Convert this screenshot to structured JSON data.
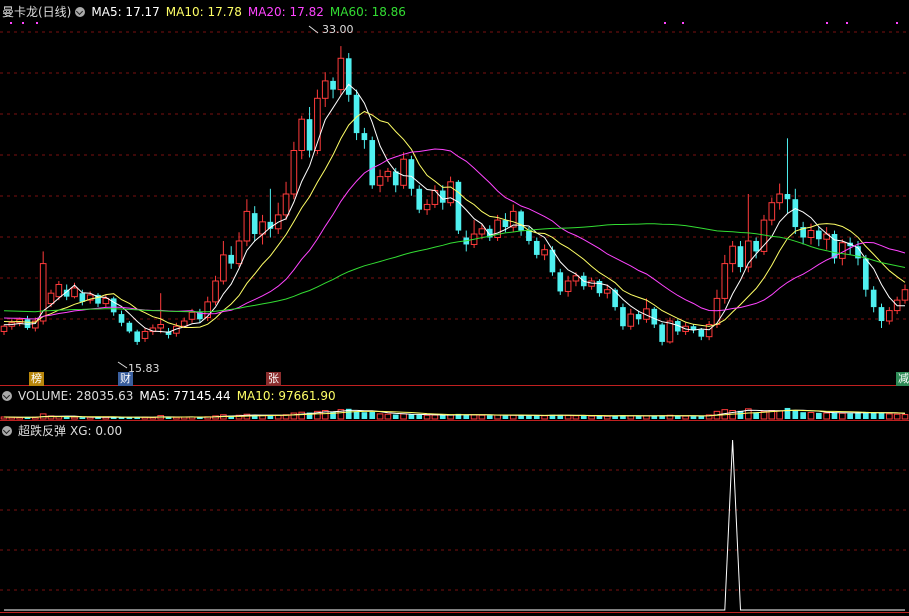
{
  "header": {
    "stock_title": "曼卡龙(日线)",
    "ma5": "MA5: 17.17",
    "ma10": "MA10: 17.78",
    "ma20": "MA20: 17.82",
    "ma60": "MA60: 18.86"
  },
  "volume_header": {
    "volume": "VOLUME: 28035.63",
    "ma5": "MA5: 77145.44",
    "ma10": "MA10: 97661.90"
  },
  "indicator_header": {
    "name": "超跌反弹",
    "xg": "XG: 0.00"
  },
  "annotations": {
    "high_label": "33.00",
    "low_label": "15.83"
  },
  "event_tags": [
    {
      "label": "榜",
      "color": "#b8860b"
    },
    {
      "label": "财",
      "color": "#3a5f9f"
    },
    {
      "label": "张",
      "color": "#8b2d2d"
    },
    {
      "label": "减",
      "color": "#2e8b57"
    }
  ],
  "colors": {
    "up": "#ff3b3b",
    "down": "#4ff0f0",
    "ma5": "#ffffff",
    "ma10": "#ffff66",
    "ma20": "#ff44ff",
    "ma60": "#33dd33",
    "grid": "#7a1010",
    "axis": "#c02020"
  },
  "chart_data": {
    "type": "candlestick",
    "price_range": [
      14.5,
      34.5
    ],
    "candles": [
      [
        16.6,
        16.9,
        16.4,
        17.0
      ],
      [
        16.9,
        17.1,
        16.7,
        17.3
      ],
      [
        17.1,
        17.3,
        16.9,
        17.4
      ],
      [
        17.3,
        16.8,
        16.7,
        17.5
      ],
      [
        16.8,
        17.2,
        16.6,
        17.4
      ],
      [
        17.2,
        20.5,
        17.0,
        21.2
      ],
      [
        18.2,
        18.8,
        18.0,
        19.0
      ],
      [
        18.6,
        19.3,
        18.4,
        19.5
      ],
      [
        19.0,
        18.6,
        18.4,
        19.3
      ],
      [
        18.6,
        19.1,
        18.5,
        19.4
      ],
      [
        18.8,
        18.3,
        18.1,
        19.0
      ],
      [
        18.4,
        18.7,
        18.2,
        18.9
      ],
      [
        18.7,
        18.2,
        18.0,
        18.8
      ],
      [
        18.2,
        18.5,
        18.0,
        18.7
      ],
      [
        18.5,
        17.7,
        17.5,
        18.6
      ],
      [
        17.6,
        17.1,
        16.9,
        17.8
      ],
      [
        17.1,
        16.6,
        16.5,
        17.2
      ],
      [
        16.6,
        16.0,
        15.83,
        16.7
      ],
      [
        16.2,
        16.6,
        16.0,
        16.8
      ],
      [
        16.6,
        16.8,
        16.4,
        17.0
      ],
      [
        16.8,
        17.0,
        16.5,
        18.8
      ],
      [
        16.6,
        16.4,
        16.2,
        16.8
      ],
      [
        16.5,
        16.9,
        16.3,
        17.1
      ],
      [
        16.9,
        17.2,
        16.8,
        17.4
      ],
      [
        17.3,
        17.7,
        17.1,
        17.9
      ],
      [
        17.7,
        17.3,
        17.1,
        17.9
      ],
      [
        17.4,
        18.3,
        17.2,
        18.6
      ],
      [
        18.3,
        19.5,
        18.1,
        19.8
      ],
      [
        19.5,
        21.0,
        19.3,
        21.8
      ],
      [
        21.0,
        20.5,
        20.2,
        21.5
      ],
      [
        20.5,
        21.8,
        20.3,
        22.3
      ],
      [
        21.8,
        23.5,
        21.5,
        24.2
      ],
      [
        23.4,
        22.2,
        21.8,
        23.8
      ],
      [
        22.2,
        22.9,
        21.6,
        23.3
      ],
      [
        22.9,
        22.5,
        22.0,
        24.8
      ],
      [
        22.5,
        23.3,
        22.2,
        24.0
      ],
      [
        23.3,
        24.5,
        23.0,
        25.2
      ],
      [
        24.5,
        27.0,
        24.2,
        27.5
      ],
      [
        27.0,
        28.8,
        26.5,
        29.0
      ],
      [
        28.8,
        27.0,
        26.6,
        29.5
      ],
      [
        27.0,
        30.0,
        26.8,
        30.5
      ],
      [
        30.0,
        31.0,
        29.5,
        31.5
      ],
      [
        31.0,
        30.5,
        30.0,
        31.2
      ],
      [
        30.5,
        32.3,
        30.2,
        33.0
      ],
      [
        32.3,
        30.2,
        29.8,
        32.6
      ],
      [
        30.2,
        28.0,
        27.6,
        30.5
      ],
      [
        28.0,
        27.6,
        27.1,
        28.3
      ],
      [
        27.6,
        25.0,
        24.8,
        27.8
      ],
      [
        25.0,
        25.5,
        24.6,
        25.9
      ],
      [
        25.5,
        25.8,
        25.2,
        26.0
      ],
      [
        25.8,
        25.0,
        24.6,
        26.0
      ],
      [
        25.0,
        26.5,
        24.8,
        26.9
      ],
      [
        26.5,
        24.8,
        24.4,
        26.7
      ],
      [
        24.8,
        23.6,
        23.4,
        25.0
      ],
      [
        23.6,
        23.9,
        23.3,
        24.2
      ],
      [
        23.9,
        24.7,
        23.7,
        25.0
      ],
      [
        24.7,
        24.0,
        23.6,
        25.0
      ],
      [
        24.0,
        25.2,
        23.8,
        25.5
      ],
      [
        25.2,
        22.4,
        22.2,
        25.3
      ],
      [
        22.0,
        21.6,
        21.2,
        22.4
      ],
      [
        21.6,
        22.2,
        21.4,
        23.0
      ],
      [
        22.2,
        22.5,
        21.9,
        22.8
      ],
      [
        22.5,
        22.0,
        21.8,
        22.7
      ],
      [
        22.0,
        23.0,
        21.8,
        23.3
      ],
      [
        23.0,
        22.6,
        22.3,
        23.4
      ],
      [
        22.6,
        23.5,
        22.3,
        23.9
      ],
      [
        23.5,
        22.4,
        22.1,
        23.6
      ],
      [
        22.4,
        21.8,
        21.6,
        22.6
      ],
      [
        21.8,
        21.0,
        20.8,
        22.0
      ],
      [
        21.0,
        21.3,
        20.7,
        21.6
      ],
      [
        21.3,
        20.0,
        19.8,
        21.5
      ],
      [
        20.0,
        18.9,
        18.7,
        20.2
      ],
      [
        18.9,
        19.5,
        18.6,
        19.8
      ],
      [
        19.5,
        19.8,
        19.2,
        20.0
      ],
      [
        19.8,
        19.2,
        19.0,
        20.0
      ],
      [
        19.2,
        19.5,
        19.0,
        19.7
      ],
      [
        19.5,
        18.8,
        18.6,
        19.6
      ],
      [
        18.8,
        19.0,
        18.5,
        19.3
      ],
      [
        19.0,
        18.0,
        17.8,
        19.1
      ],
      [
        18.0,
        16.9,
        16.7,
        18.2
      ],
      [
        16.9,
        17.6,
        16.7,
        17.9
      ],
      [
        17.6,
        17.3,
        17.0,
        17.8
      ],
      [
        17.3,
        17.9,
        17.1,
        18.5
      ],
      [
        17.9,
        17.0,
        16.8,
        18.0
      ],
      [
        17.0,
        16.0,
        15.8,
        17.1
      ],
      [
        16.0,
        17.2,
        15.9,
        17.4
      ],
      [
        17.2,
        16.6,
        16.4,
        17.3
      ],
      [
        16.6,
        16.9,
        16.4,
        17.1
      ],
      [
        16.9,
        16.7,
        16.5,
        17.0
      ],
      [
        16.7,
        16.3,
        16.1,
        16.8
      ],
      [
        16.3,
        17.0,
        16.1,
        17.2
      ],
      [
        17.0,
        18.5,
        16.8,
        19.0
      ],
      [
        18.5,
        20.5,
        18.2,
        21.0
      ],
      [
        20.5,
        21.5,
        20.0,
        21.8
      ],
      [
        21.5,
        20.3,
        20.0,
        21.8
      ],
      [
        20.3,
        21.8,
        20.0,
        24.5
      ],
      [
        21.8,
        21.2,
        20.8,
        22.0
      ],
      [
        21.2,
        23.0,
        21.0,
        23.3
      ],
      [
        23.0,
        24.0,
        22.7,
        24.3
      ],
      [
        24.0,
        24.5,
        23.6,
        25.1
      ],
      [
        24.5,
        24.2,
        23.4,
        27.7
      ],
      [
        24.2,
        22.6,
        22.2,
        24.8
      ],
      [
        22.6,
        22.0,
        21.6,
        22.9
      ],
      [
        22.0,
        22.4,
        21.6,
        22.8
      ],
      [
        22.4,
        21.9,
        21.5,
        22.6
      ],
      [
        21.9,
        22.2,
        21.3,
        22.6
      ],
      [
        22.2,
        20.8,
        20.5,
        22.4
      ],
      [
        20.8,
        21.7,
        20.4,
        21.9
      ],
      [
        21.7,
        21.5,
        21.0,
        22.0
      ],
      [
        21.5,
        20.8,
        20.4,
        21.8
      ],
      [
        20.8,
        19.0,
        18.6,
        21.0
      ],
      [
        19.0,
        18.0,
        17.7,
        19.2
      ],
      [
        18.0,
        17.2,
        16.8,
        18.2
      ],
      [
        17.2,
        17.8,
        17.0,
        18.0
      ],
      [
        17.8,
        18.4,
        17.6,
        18.6
      ],
      [
        18.4,
        19.0,
        18.2,
        19.3
      ]
    ],
    "volume_scale_max": 100,
    "volumes": [
      12,
      10,
      9,
      11,
      10,
      30,
      18,
      14,
      12,
      11,
      10,
      10,
      9,
      10,
      12,
      11,
      10,
      12,
      10,
      9,
      20,
      10,
      10,
      11,
      12,
      11,
      13,
      18,
      25,
      20,
      22,
      28,
      24,
      20,
      22,
      21,
      25,
      35,
      40,
      38,
      45,
      50,
      42,
      55,
      60,
      45,
      40,
      42,
      30,
      28,
      26,
      30,
      27,
      25,
      22,
      23,
      22,
      24,
      30,
      26,
      24,
      22,
      21,
      23,
      20,
      22,
      21,
      20,
      22,
      19,
      25,
      24,
      20,
      19,
      18,
      17,
      19,
      16,
      20,
      22,
      18,
      17,
      18,
      19,
      21,
      22,
      18,
      17,
      16,
      18,
      24,
      45,
      55,
      50,
      48,
      60,
      40,
      45,
      50,
      48,
      65,
      52,
      40,
      38,
      36,
      35,
      40,
      34,
      33,
      36,
      42,
      40,
      38,
      30,
      28,
      26
    ],
    "xg_signal_index": 93,
    "xg_signal_value": 1
  }
}
